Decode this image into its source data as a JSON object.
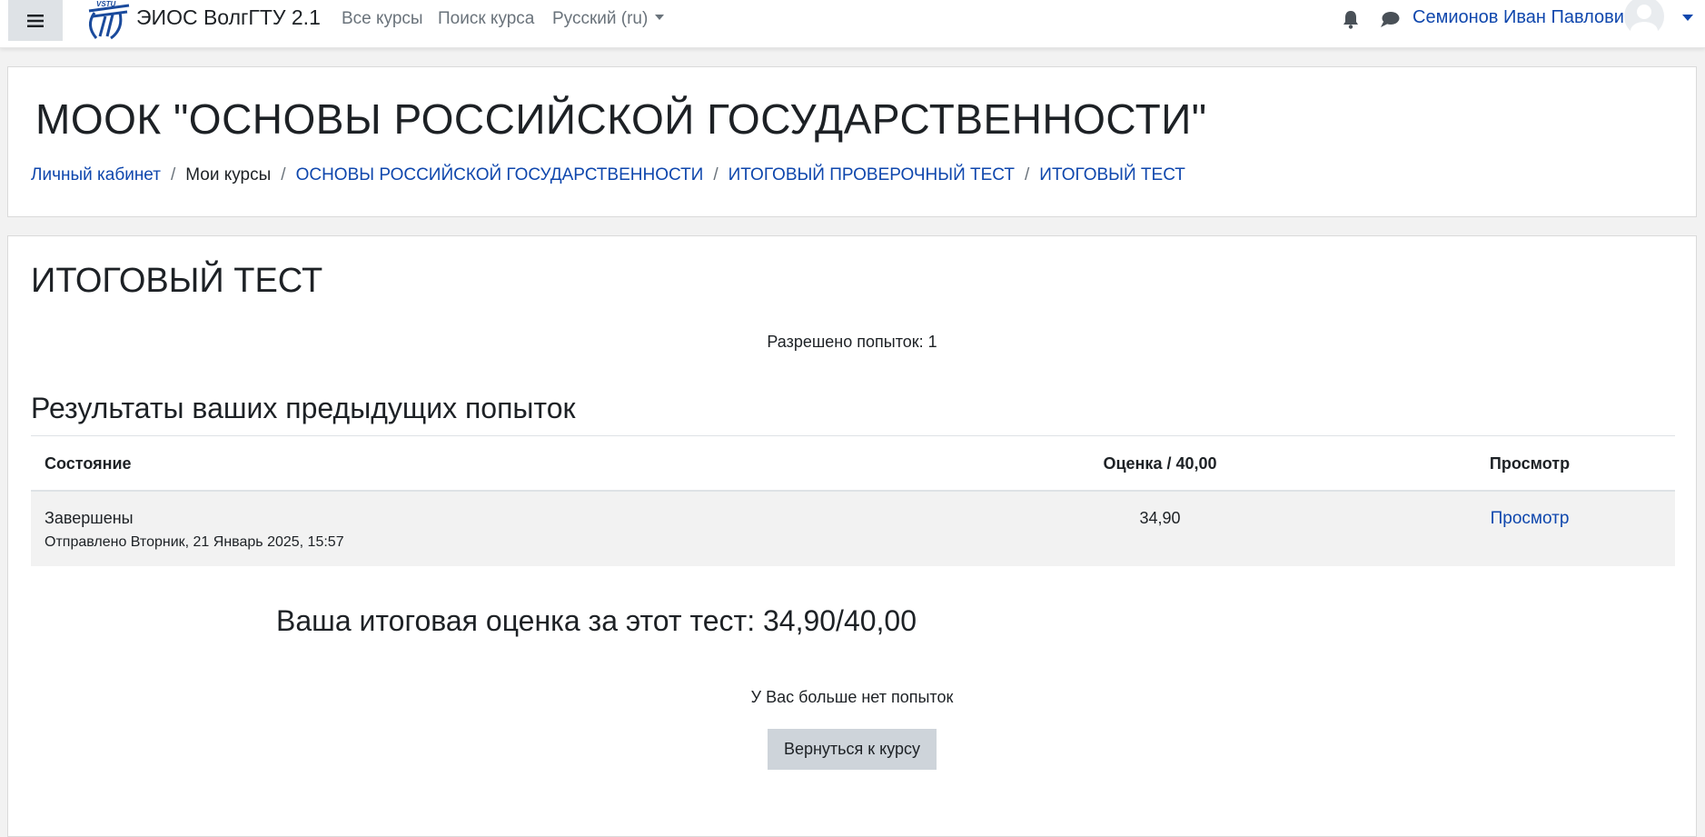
{
  "navbar": {
    "site_name": "ЭИОС ВолгГТУ 2.1",
    "links": [
      "Все курсы",
      "Поиск курса",
      "Русский (ru)"
    ],
    "user_name": "Семионов Иван Павлович",
    "icons": [
      "menu-icon",
      "logo-icon",
      "bell-icon",
      "chat-icon",
      "avatar-icon"
    ],
    "logo_text": "VSTU"
  },
  "header": {
    "course_title": "МООК \"ОСНОВЫ РОССИЙСКОЙ ГОСУДАРСТВЕННОСТИ\"",
    "breadcrumb": [
      {
        "label": "Личный кабинет",
        "link": true
      },
      {
        "label": "Мои курсы",
        "link": false
      },
      {
        "label": "ОСНОВЫ РОССИЙСКОЙ ГОСУДАРСТВЕННОСТИ",
        "link": true
      },
      {
        "label": "ИТОГОВЫЙ ПРОВЕРОЧНЫЙ ТЕСТ",
        "link": true
      },
      {
        "label": "ИТОГОВЫЙ ТЕСТ",
        "link": true
      }
    ]
  },
  "main": {
    "quiz_title": "ИТОГОВЫЙ ТЕСТ",
    "attempts_allowed": "Разрешено попыток: 1",
    "results_heading": "Результаты ваших предыдущих попыток",
    "table": {
      "headers": [
        "Состояние",
        "Оценка / 40,00",
        "Просмотр"
      ],
      "rows": [
        {
          "state": "Завершены",
          "submitted": "Отправлено Вторник, 21 Январь 2025, 15:57",
          "grade": "34,90",
          "review": "Просмотр"
        }
      ]
    },
    "final_grade": "Ваша итоговая оценка за этот тест: 34,90/40,00",
    "no_more_attempts": "У Вас больше нет попыток",
    "back_button": "Вернуться к курсу"
  },
  "colors": {
    "link": "#0f47ad",
    "page_bg": "#f2f2f2",
    "button_bg": "#ced4da",
    "toggle_bg": "#dee2e6"
  }
}
